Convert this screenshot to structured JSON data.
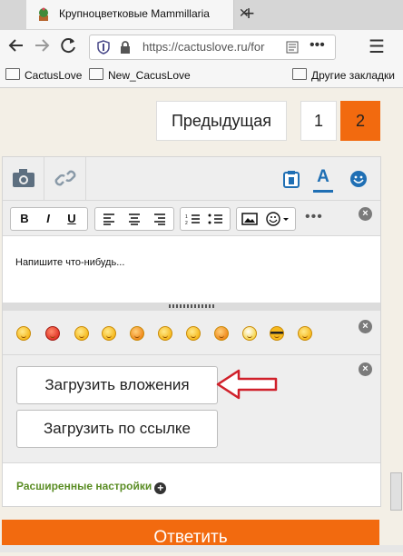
{
  "browser": {
    "tab_title": "Крупноцветковые Mammillaria",
    "tab_close": "✕",
    "new_tab": "+",
    "url": "https://cactuslove.ru/for",
    "url_menu": "•••",
    "bookmarks": [
      "CactusLove",
      "New_CacusLove"
    ],
    "other_bookmarks": "Другие закладки"
  },
  "pager": {
    "prev": "Предыдущая",
    "pages": [
      "1",
      "2"
    ],
    "active": "2"
  },
  "editor": {
    "placeholder": "Напишите что-нибудь...",
    "more": "•••",
    "close": "×",
    "format_buttons": [
      "B",
      "I",
      "U"
    ]
  },
  "attachments": {
    "upload": "Загрузить вложения",
    "upload_link": "Загрузить по ссылке"
  },
  "advanced": {
    "label": "Расширенные настройки",
    "plus": "+"
  },
  "reply": "Ответить",
  "colors": {
    "accent": "#f26a0f",
    "link": "#5b8d25",
    "arrow": "#d0202a",
    "icon": "#1f6fb4"
  }
}
